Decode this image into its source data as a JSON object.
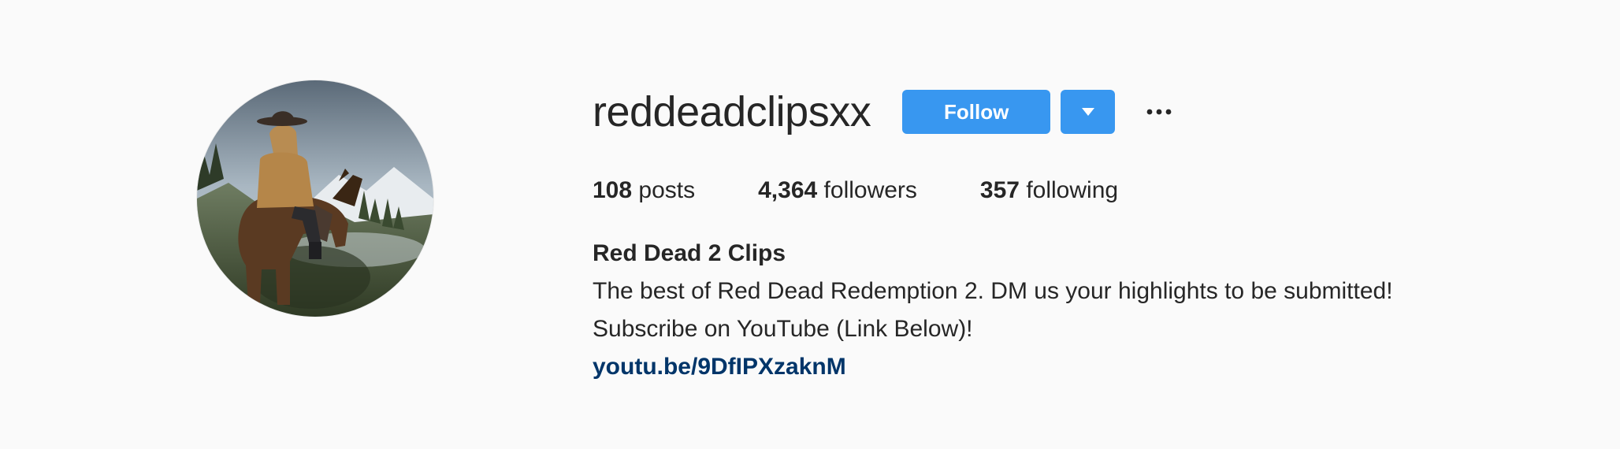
{
  "profile": {
    "username": "reddeadclipsxx",
    "follow_label": "Follow",
    "dropdown_icon": "caret-down-icon",
    "more_icon": "ellipsis-icon",
    "stats": {
      "posts_count": "108",
      "posts_label": "posts",
      "followers_count": "4,364",
      "followers_label": "followers",
      "following_count": "357",
      "following_label": "following"
    },
    "bio": {
      "name": "Red Dead 2 Clips",
      "line1": "The best of Red Dead Redemption 2. DM us your highlights to be submitted!",
      "line2": "Subscribe on YouTube (Link Below)!",
      "link": "youtu.be/9DfIPXzaknM"
    }
  },
  "colors": {
    "background": "#fafafa",
    "button": "#3897f0",
    "text": "#262626",
    "link": "#003569"
  }
}
